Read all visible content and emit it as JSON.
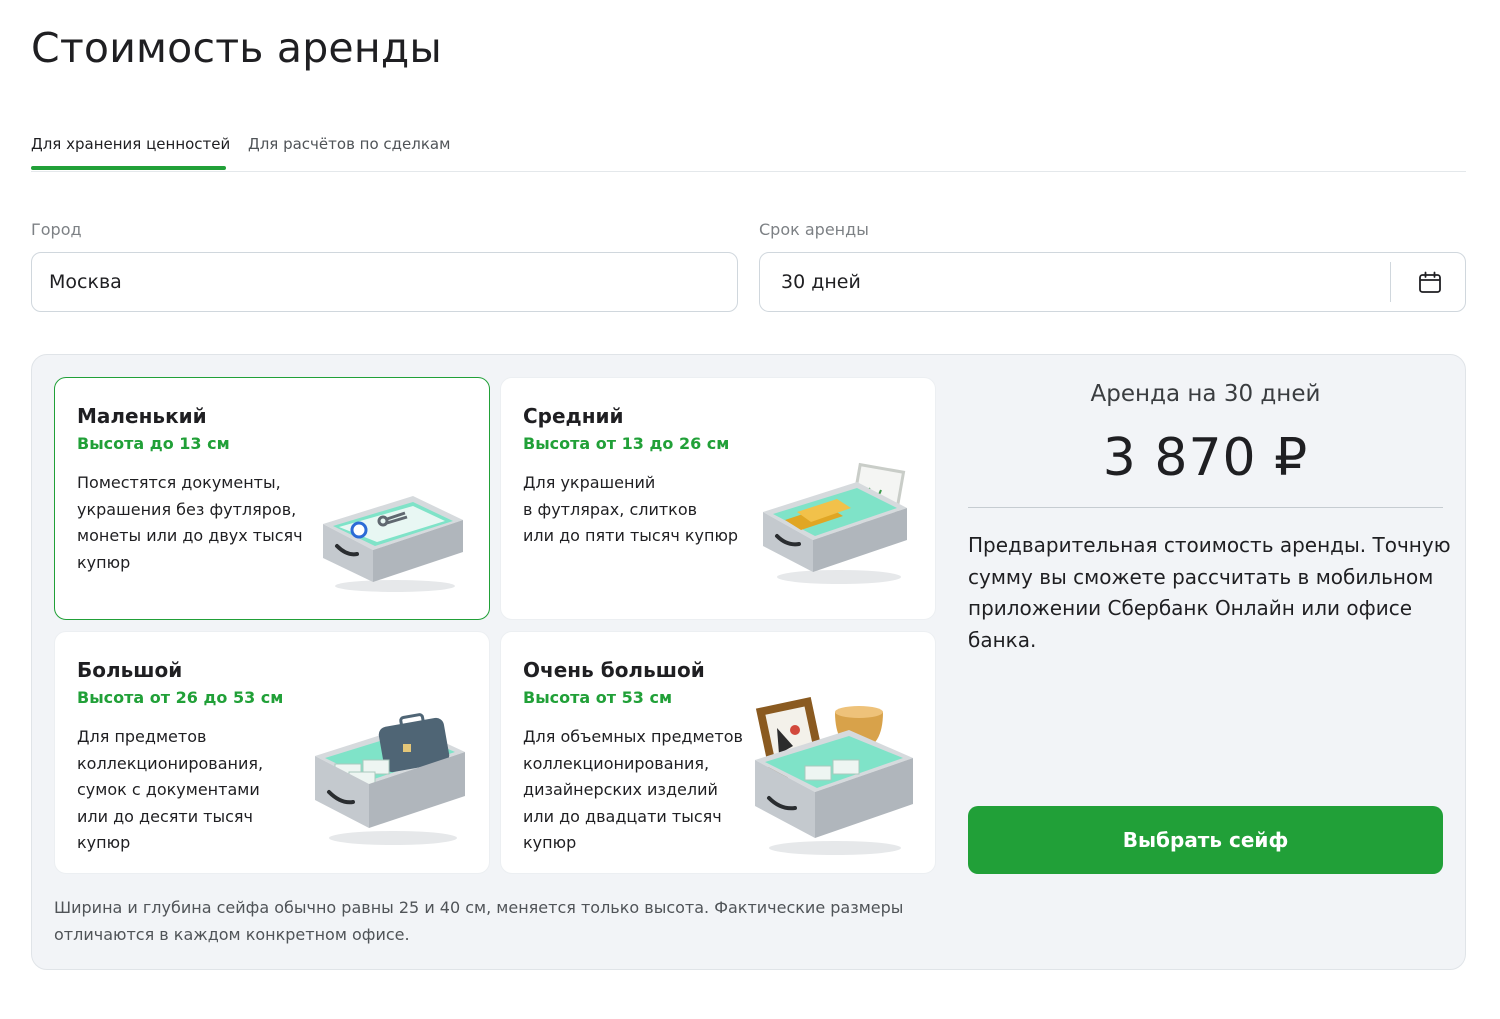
{
  "page": {
    "title": "Стоимость аренды"
  },
  "tabs": [
    {
      "label": "Для хранения ценностей",
      "active": true
    },
    {
      "label": "Для расчётов по сделкам",
      "active": false
    }
  ],
  "form": {
    "city": {
      "label": "Город",
      "value": "Москва"
    },
    "term": {
      "label": "Срок аренды",
      "value": "30 дней",
      "icon": "calendar-icon"
    }
  },
  "cards": [
    {
      "title": "Маленький",
      "height": "Высота до 13 см",
      "selected": true,
      "desc": [
        "Поместятся документы,",
        "украшения без футляров,",
        "монеты или до двух тысяч",
        "купюр"
      ],
      "image": "small-safe-box"
    },
    {
      "title": "Средний",
      "height": "Высота от 13 до 26 см",
      "selected": false,
      "desc": [
        "Для украшений",
        "в футлярах, слитков",
        "или до пяти тысяч купюр"
      ],
      "image": "medium-safe-box"
    },
    {
      "title": "Большой",
      "height": "Высота от 26 до 53 см",
      "selected": false,
      "desc": [
        "Для предметов",
        "коллекционирования,",
        "сумок с документами",
        "или до десяти тысяч",
        "купюр"
      ],
      "image": "large-safe-box"
    },
    {
      "title": "Очень большой",
      "height": "Высота от 53 см",
      "selected": false,
      "desc": [
        "Для объемных предметов",
        "коллекционирования,",
        "дизайнерских изделий",
        "или до двадцати тысяч",
        "купюр"
      ],
      "image": "extra-large-safe-box"
    }
  ],
  "summary": {
    "heading": "Аренда на 30 дней",
    "price": "3 870 ₽",
    "note": [
      "Предварительная стоимость аренды. Точную",
      "сумму вы сможете рассчитать в мобильном",
      "приложении Сбербанк Онлайн или офисе",
      "банка."
    ],
    "button": "Выбрать сейф"
  },
  "footnote": [
    "Ширина и глубина сейфа обычно равны 25 и 40 см, меняется только высота. Фактические размеры",
    "отличаются в каждом конкретном офисе."
  ],
  "colors": {
    "accent": "#21a038",
    "panel": "#f2f4f7",
    "text": "#1f1f22"
  }
}
